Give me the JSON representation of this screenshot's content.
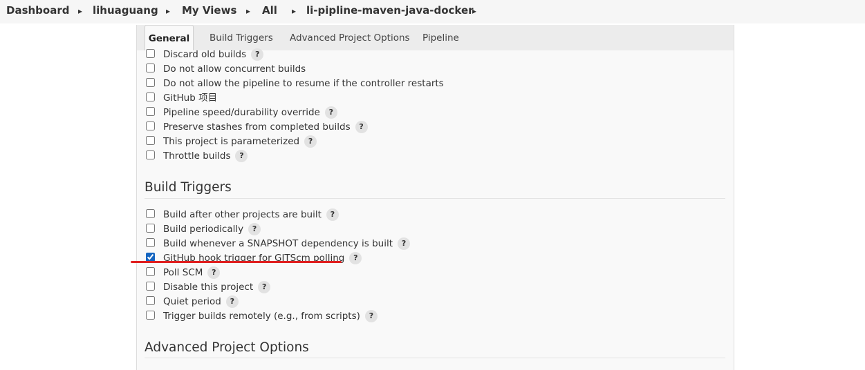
{
  "breadcrumb": {
    "items": [
      {
        "label": "Dashboard"
      },
      {
        "label": "lihuaguang"
      },
      {
        "label": "My Views"
      },
      {
        "label": "All"
      },
      {
        "label": "li-pipline-maven-java-docker"
      }
    ]
  },
  "tabs": [
    {
      "label": "General",
      "active": true
    },
    {
      "label": "Build Triggers",
      "active": false
    },
    {
      "label": "Advanced Project Options",
      "active": false
    },
    {
      "label": "Pipeline",
      "active": false
    }
  ],
  "general": {
    "options": [
      {
        "label": "Discard old builds",
        "checked": false,
        "help": "?"
      },
      {
        "label": "Do not allow concurrent builds",
        "checked": false
      },
      {
        "label": "Do not allow the pipeline to resume if the controller restarts",
        "checked": false
      },
      {
        "label": "GitHub 项目",
        "checked": false
      },
      {
        "label": "Pipeline speed/durability override",
        "checked": false,
        "help": "?"
      },
      {
        "label": "Preserve stashes from completed builds",
        "checked": false,
        "help": "?"
      },
      {
        "label": "This project is parameterized",
        "checked": false,
        "help": "?"
      },
      {
        "label": "Throttle builds",
        "checked": false,
        "help": "?"
      }
    ]
  },
  "build_triggers": {
    "title": "Build Triggers",
    "options": [
      {
        "label": "Build after other projects are built",
        "checked": false,
        "help": "?"
      },
      {
        "label": "Build periodically",
        "checked": false,
        "help": "?"
      },
      {
        "label": "Build whenever a SNAPSHOT dependency is built",
        "checked": false,
        "help": "?"
      },
      {
        "label": "GitHub hook trigger for GITScm polling",
        "checked": true,
        "help": "?"
      },
      {
        "label": "Poll SCM",
        "checked": false,
        "help": "?"
      },
      {
        "label": "Disable this project",
        "checked": false,
        "help": "?"
      },
      {
        "label": "Quiet period",
        "checked": false,
        "help": "?"
      },
      {
        "label": "Trigger builds remotely (e.g., from scripts)",
        "checked": false,
        "help": "?"
      }
    ]
  },
  "advanced": {
    "title": "Advanced Project Options"
  },
  "colors": {
    "accent": "#1565c0",
    "annotation": "#e02020"
  }
}
